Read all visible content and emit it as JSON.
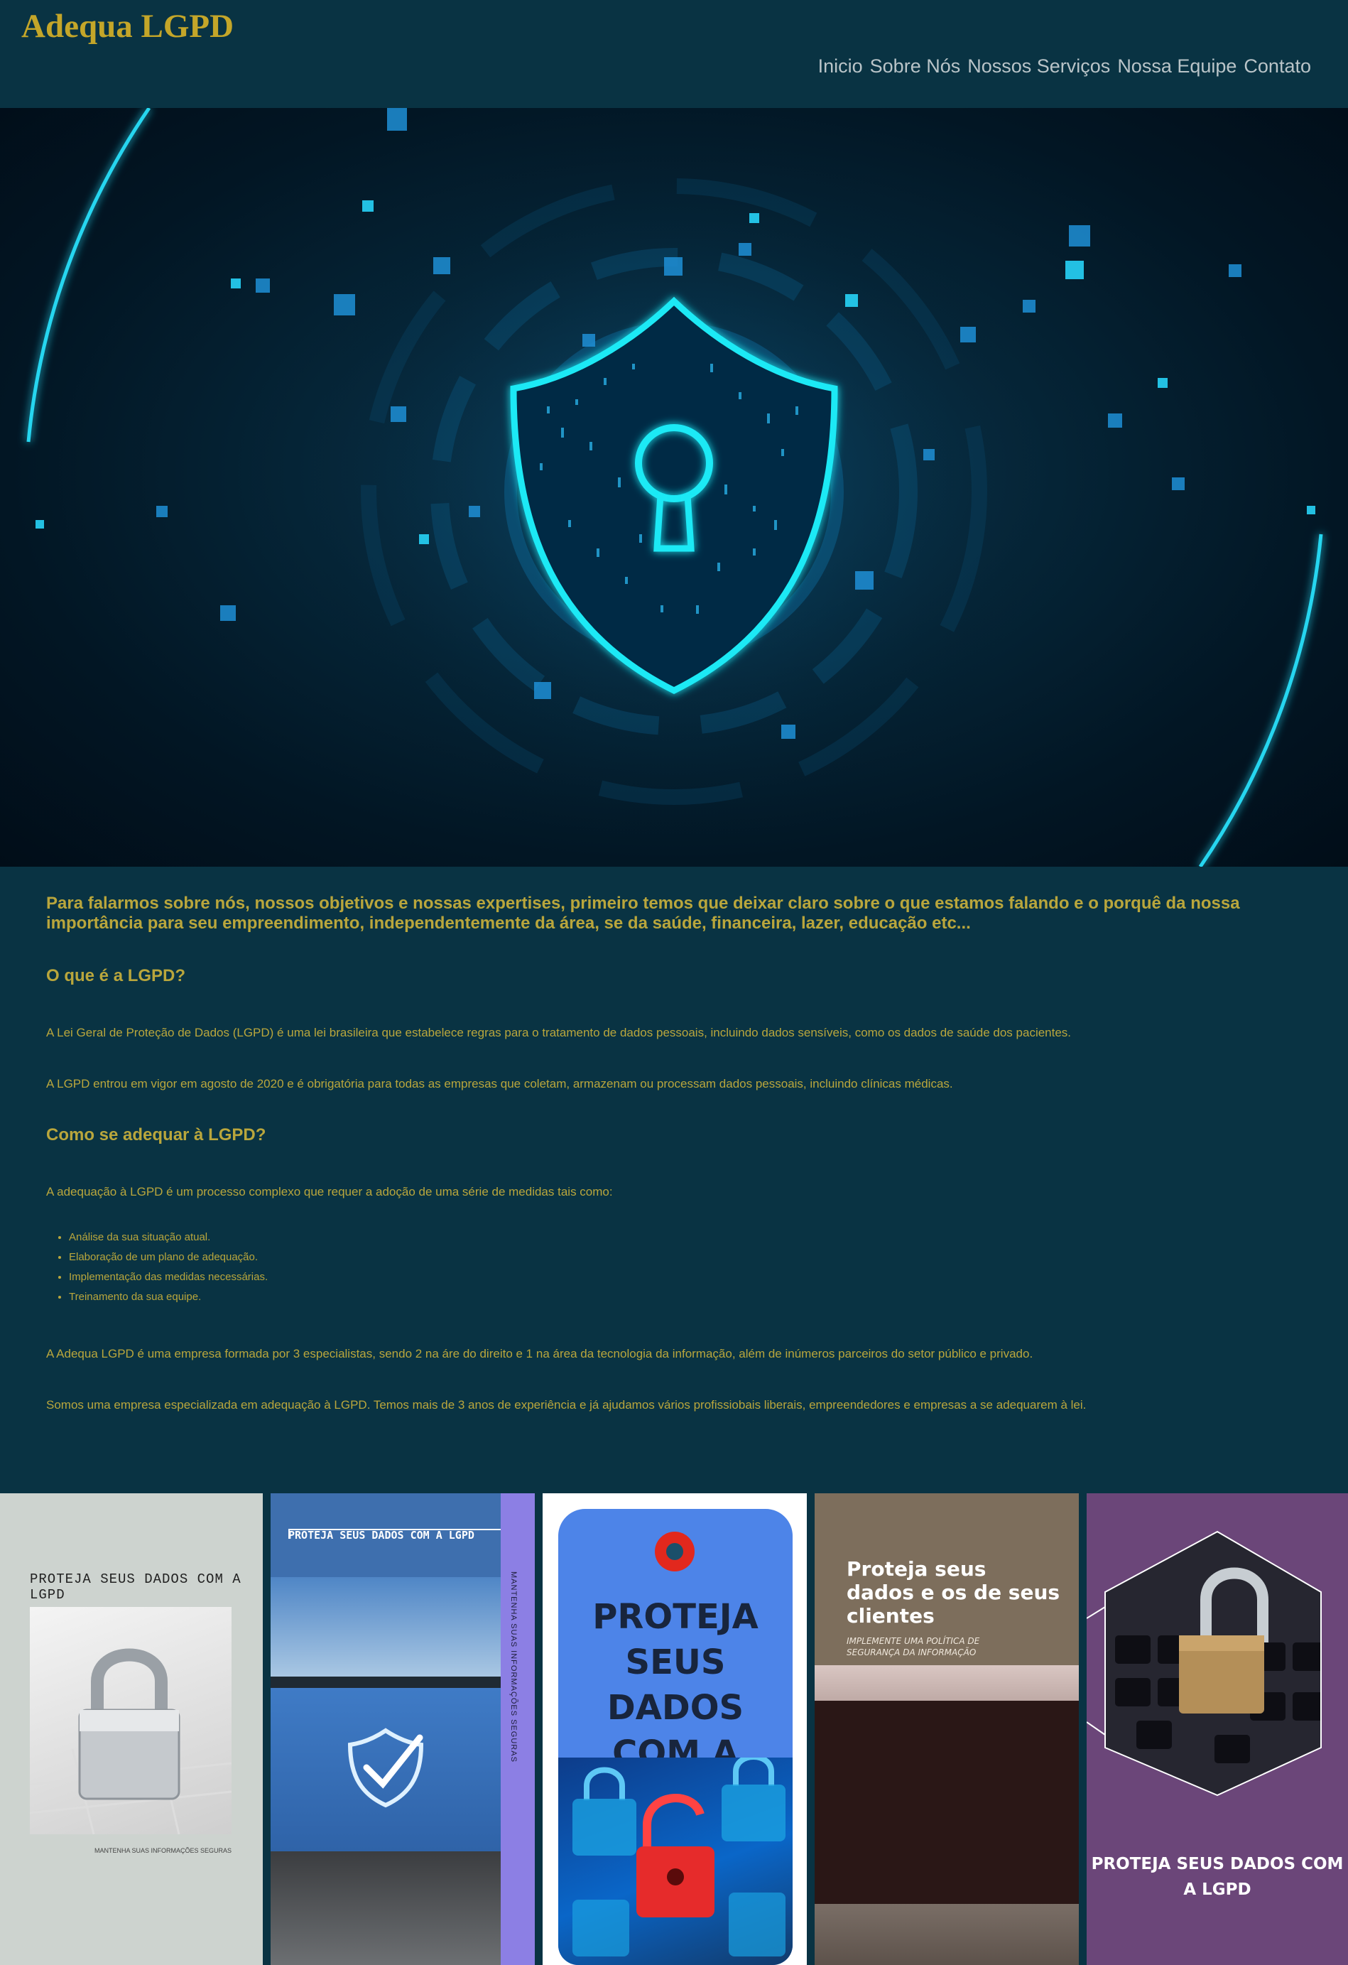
{
  "brand": "Adequa LGPD",
  "nav": [
    "Inicio",
    "Sobre Nós",
    "Nossos Serviços",
    "Nossa Equipe",
    "Contato"
  ],
  "lead": "Para falarmos sobre nós, nossos objetivos e nossas expertises, primeiro temos que deixar claro sobre o que estamos falando e o porquê da nossa importância para seu empreendimento, independentemente da área, se da saúde, financeira, lazer, educação etc...",
  "section1": {
    "heading": "O que é a LGPD?",
    "p1": "A Lei Geral de Proteção de Dados (LGPD) é uma lei brasileira que estabelece regras para o tratamento de dados pessoais, incluindo dados sensíveis, como os dados de saúde dos pacientes.",
    "p2": "A LGPD entrou em vigor em agosto de 2020 e é obrigatória para todas as empresas que coletam, armazenam ou processam dados pessoais, incluindo clínicas médicas."
  },
  "section2": {
    "heading": "Como se adequar à LGPD?",
    "intro": "A adequação à LGPD é um processo complexo que requer a adoção de uma série de medidas tais como:",
    "items": [
      "Análise da sua situação atual.",
      "Elaboração de um plano de adequação.",
      "Implementação das medidas necessárias.",
      "Treinamento da sua equipe."
    ],
    "p3": "A Adequa LGPD é uma empresa formada por 3 especialistas, sendo 2 na áre do direito e 1 na área da tecnologia da informação, além de inúmeros parceiros do setor público e privado.",
    "p4": "Somos uma empresa especializada em adequação à LGPD. Temos mais de 3 anos de experiência e já ajudamos vários profissiobais liberais, empreendedores e empresas a se adequarem à lei."
  },
  "cards": {
    "c1": {
      "title": "PROTEJA SEUS DADOS COM A LGPD",
      "footer": "MANTENHA SUAS INFORMAÇÕES SEGURAS"
    },
    "c2": {
      "title": "PROTEJA SEUS DADOS COM A LGPD",
      "side": "MANTENHA SUAS INFORMAÇÕES SEGURAS"
    },
    "c3": {
      "line1": "PROTEJA",
      "line2": "SEUS DADOS",
      "line3": "COM A LGPD"
    },
    "c4": {
      "title1": "Proteja seus",
      "title2": "dados e os de seus",
      "title3": "clientes",
      "sub1": "IMPLEMENTE UMA POLÍTICA DE",
      "sub2": "SEGURANÇA DA INFORMAÇÃO"
    },
    "c5": {
      "title1": "PROTEJA SEUS DADOS COM",
      "title2": "A LGPD"
    }
  },
  "colors": {
    "background": "#093343",
    "accent": "#c4a629",
    "text": "#b9a63c",
    "hero_glow": "#1de9f5"
  }
}
